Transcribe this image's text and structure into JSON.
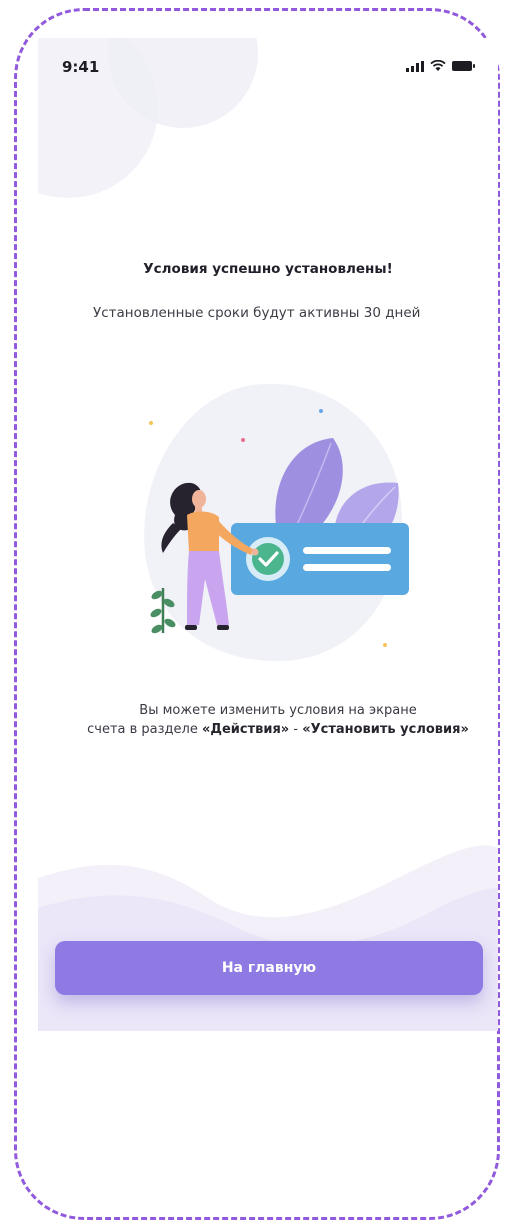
{
  "status_bar": {
    "time": "9:41"
  },
  "success": {
    "title": "Условия успешно установлены!",
    "subtitle": "Установленные сроки будут активны 30 дней"
  },
  "info": {
    "line1": "Вы можете изменить условия на экране",
    "line2_prefix": "счета в разделе ",
    "actions": "«Действия»",
    "separator": " - ",
    "set_conditions": "«Установить условия»"
  },
  "button": {
    "label": "На главную"
  },
  "colors": {
    "accent": "#8f7ae4",
    "frame_dash": "#9159dc",
    "card_blue": "#5aa8e0",
    "check_green": "#4bb58e",
    "leaf_purple": "#9f8fe0"
  },
  "icons": [
    "signal-icon",
    "wifi-icon",
    "battery-icon",
    "check-icon"
  ]
}
